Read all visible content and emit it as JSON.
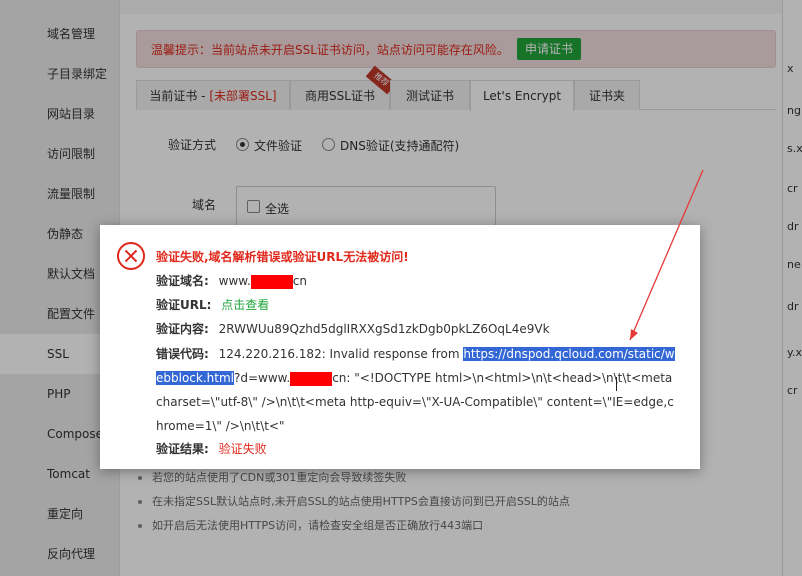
{
  "sidebar": {
    "items": [
      {
        "label": "域名管理"
      },
      {
        "label": "子目录绑定"
      },
      {
        "label": "网站目录"
      },
      {
        "label": "访问限制"
      },
      {
        "label": "流量限制"
      },
      {
        "label": "伪静态"
      },
      {
        "label": "默认文档"
      },
      {
        "label": "配置文件"
      },
      {
        "label": "SSL"
      },
      {
        "label": "PHP"
      },
      {
        "label": "Composer"
      },
      {
        "label": "Tomcat"
      },
      {
        "label": "重定向"
      },
      {
        "label": "反向代理"
      }
    ]
  },
  "warning": {
    "text": "温馨提示：当前站点未开启SSL证书访问，站点访问可能存在风险。",
    "button": "申请证书"
  },
  "tabs": {
    "current_prefix": "当前证书 - ",
    "current_status": "[未部署SSL]",
    "commercial": "商用SSL证书",
    "ribbon": "推荐",
    "test": "测试证书",
    "letsencrypt": "Let's Encrypt",
    "folder": "证书夹"
  },
  "form": {
    "verify_method_label": "验证方式",
    "file_verify": "文件验证",
    "dns_verify": "DNS验证(支持通配符)",
    "domain_label": "域名",
    "select_all": "全选"
  },
  "tips": [
    "若您的站点使用了CDN或301重定向会导致续签失败",
    "在未指定SSL默认站点时,未开启SSL的站点使用HTTPS会直接访问到已开启SSL的站点",
    "如开启后无法使用HTTPS访问，请检查安全组是否正确放行443端口"
  ],
  "right_fragments": [
    "x",
    "ng",
    "s.x",
    "cr",
    "dr",
    "ne",
    "dr",
    "y.x",
    "cr"
  ],
  "dialog": {
    "title": "验证失败,域名解析错误或验证URL无法被访问!",
    "domain_label": "验证域名:",
    "domain_prefix": "www.",
    "domain_suffix": "cn",
    "url_label": "验证URL:",
    "url_link": "点击查看",
    "content_label": "验证内容:",
    "content_value": "2RWWUu89Qzhd5dglIRXXgSd1zkDgb0pkLZ6OqL4e9Vk",
    "code_label": "错误代码:",
    "code_lead": "124.220.216.182: Invalid response from ",
    "code_url_line1": "https://dnspod.qcloud.co",
    "code_url_line2": "m/static/webblock.html",
    "code_mid": "?d=www.",
    "code_rest_a": "cn: \"<!DOCTYPE html>\\n<html>\\n\\t<",
    "code_rest_b": "head>\\n\\t\\t<meta charset=\\\"utf-8\\\" />\\n\\t\\t<meta http-equiv=\\\"X-UA-Com",
    "code_rest_c": "patible\\\" content=\\\"IE=edge,chrome=1\\\" />\\n\\t\\t<\"",
    "result_label": "验证结果:",
    "result_value": "验证失败"
  },
  "colors": {
    "accent_green": "#20a53a",
    "error_red": "#e0291c",
    "selection_blue": "#3367d6",
    "annotation_arrow": "#e53935"
  }
}
